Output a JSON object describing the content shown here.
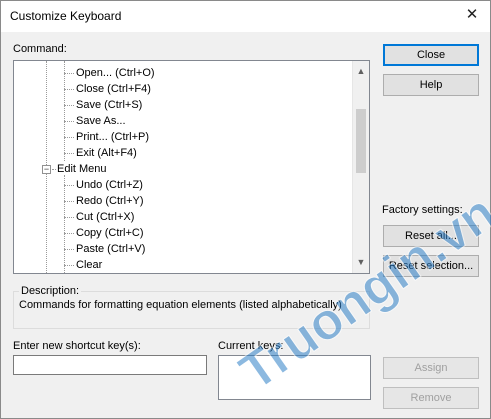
{
  "window": {
    "title": "Customize Keyboard",
    "close_glyph": "✕"
  },
  "command": {
    "label": "Command:",
    "items": [
      {
        "label": "Open... (Ctrl+O)"
      },
      {
        "label": "Close (Ctrl+F4)"
      },
      {
        "label": "Save (Ctrl+S)"
      },
      {
        "label": "Save As..."
      },
      {
        "label": "Print... (Ctrl+P)"
      },
      {
        "label": "Exit (Alt+F4)"
      },
      {
        "label": "Edit Menu",
        "expander": "−"
      },
      {
        "label": "Undo (Ctrl+Z)"
      },
      {
        "label": "Redo (Ctrl+Y)"
      },
      {
        "label": "Cut (Ctrl+X)"
      },
      {
        "label": "Copy (Ctrl+C)"
      },
      {
        "label": "Paste (Ctrl+V)"
      },
      {
        "label": "Clear"
      }
    ],
    "scroll_up": "▲",
    "scroll_down": "▼"
  },
  "buttons": {
    "close": "Close",
    "help": "Help",
    "reset_all": "Reset all...",
    "reset_selection": "Reset selection...",
    "assign": "Assign",
    "remove": "Remove"
  },
  "factory": {
    "label": "Factory settings:"
  },
  "description": {
    "label": "Description:",
    "text": "Commands for formatting equation elements  (listed alphabetically)"
  },
  "shortcut": {
    "label": "Enter new shortcut key(s):",
    "value": "",
    "current_label": "Current keys:"
  },
  "watermark": {
    "text": "Truongin.vn"
  }
}
